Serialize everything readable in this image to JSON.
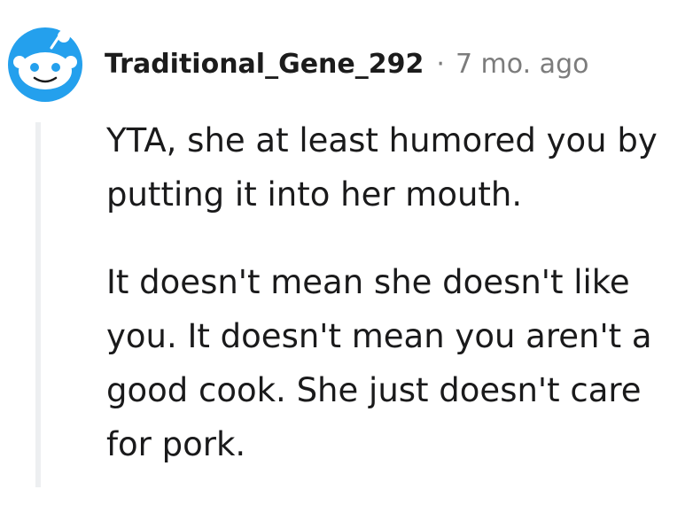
{
  "comment": {
    "avatar_icon": "reddit-snoo-avatar-icon",
    "author": "Traditional_Gene_292",
    "separator": "·",
    "timestamp": "7 mo. ago",
    "paragraphs": [
      "YTA, she at least humored you by putting it into her mouth.",
      "It doesn't mean she doesn't like you. It doesn't mean you aren't a good cook. She just doesn't care for pork."
    ]
  },
  "colors": {
    "avatar_bg": "#24a0ed",
    "text": "#1a1a1b",
    "meta_gray": "#7c7c7c",
    "thread_line": "#edeff1"
  }
}
